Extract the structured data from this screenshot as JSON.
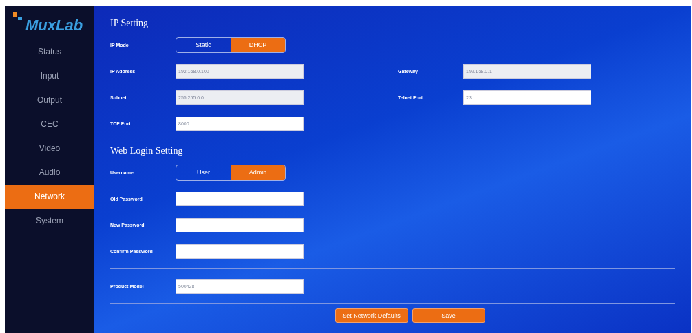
{
  "logo": {
    "text": "MuxLab"
  },
  "sidebar": {
    "items": [
      {
        "label": "Status",
        "selected": false
      },
      {
        "label": "Input",
        "selected": false
      },
      {
        "label": "Output",
        "selected": false
      },
      {
        "label": "CEC",
        "selected": false
      },
      {
        "label": "Video",
        "selected": false
      },
      {
        "label": "Audio",
        "selected": false
      },
      {
        "label": "Network",
        "selected": true
      },
      {
        "label": "System",
        "selected": false
      }
    ]
  },
  "ip_setting": {
    "title": "IP Setting",
    "ip_mode": {
      "label": "IP Mode",
      "options": [
        {
          "label": "Static",
          "selected": false
        },
        {
          "label": "DHCP",
          "selected": true
        }
      ]
    },
    "fields": [
      {
        "label": "IP Address",
        "value": "192.168.0.100",
        "disabled": true
      },
      {
        "label": "Gateway",
        "value": "192.168.0.1",
        "disabled": true
      },
      {
        "label": "Subnet",
        "value": "255.255.0.0",
        "disabled": true
      },
      {
        "label": "Telnet Port",
        "value": "23",
        "disabled": false
      },
      {
        "label": "TCP Port",
        "value": "8000",
        "disabled": false
      }
    ]
  },
  "web_login_setting": {
    "title": "Web Login Setting",
    "username": {
      "label": "Username",
      "options": [
        {
          "label": "User",
          "selected": false
        },
        {
          "label": "Admin",
          "selected": true
        }
      ]
    },
    "fields": [
      {
        "label": "Old Password"
      },
      {
        "label": "New Password"
      },
      {
        "label": "Confirm Password"
      }
    ]
  },
  "product_model": {
    "label": "Product Model",
    "value": "500428"
  },
  "buttons": [
    "Set Network Defaults",
    "Save"
  ]
}
